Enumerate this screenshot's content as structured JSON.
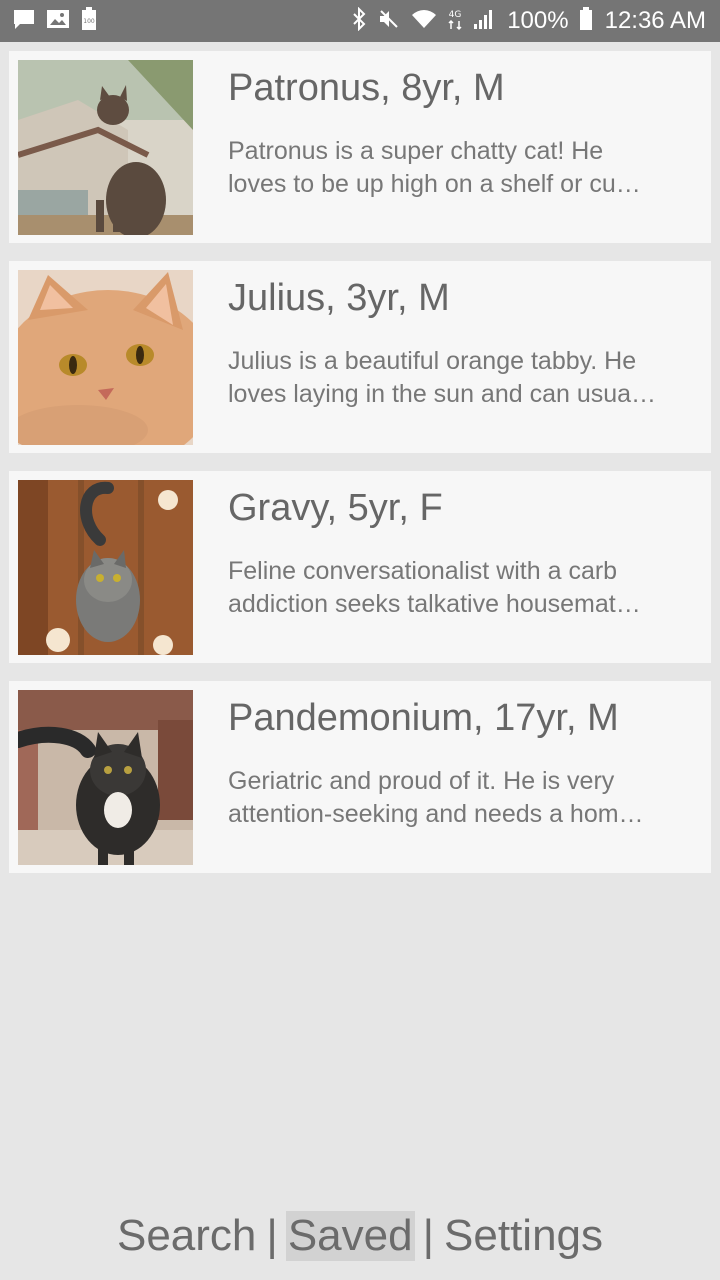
{
  "status_bar": {
    "battery_percent": "100%",
    "time": "12:36 AM",
    "network_label": "4G",
    "left_icons": [
      "message-icon",
      "image-icon",
      "battery-saver-icon"
    ],
    "right_icons": [
      "bluetooth-icon",
      "mute-icon",
      "wifi-icon",
      "network-type-icon",
      "signal-icon",
      "battery-icon"
    ]
  },
  "cats": [
    {
      "title": "Patronus, 8yr, M",
      "desc_line1": "Patronus is a super chatty cat! He",
      "desc_line2": "loves to be up high on a shelf or cu…"
    },
    {
      "title": "Julius, 3yr, M",
      "desc_line1": "Julius is a beautiful orange tabby. He",
      "desc_line2": "loves laying in the sun and can usua…"
    },
    {
      "title": "Gravy, 5yr, F",
      "desc_line1": "Feline conversationalist with a carb",
      "desc_line2": "addiction seeks talkative housemat…"
    },
    {
      "title": "Pandemonium, 17yr, M",
      "desc_line1": "Geriatric and proud of it. He is very",
      "desc_line2": "attention-seeking and needs a hom…"
    }
  ],
  "nav": {
    "search_label": "Search",
    "saved_label": "Saved",
    "settings_label": "Settings",
    "separator": "|",
    "active": "Saved"
  },
  "colors": {
    "status_bar_bg": "#757575",
    "page_bg": "#e6e6e6",
    "card_bg": "#f7f7f7",
    "text": "#666666",
    "nav_active_bg": "#d2d2d2"
  }
}
